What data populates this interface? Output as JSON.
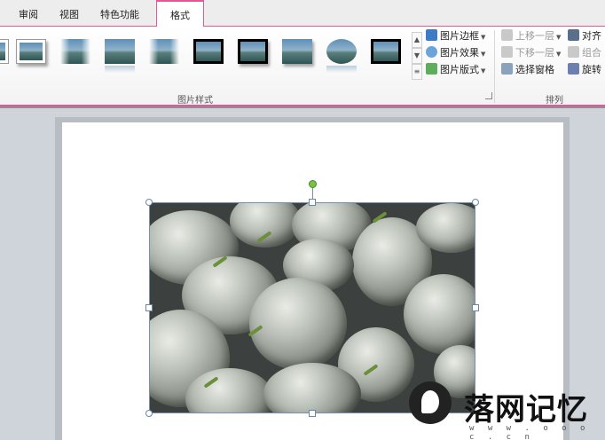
{
  "tabs": [
    {
      "label": "审阅",
      "active": false
    },
    {
      "label": "视图",
      "active": false
    },
    {
      "label": "特色功能",
      "active": false
    },
    {
      "label": "格式",
      "active": true
    }
  ],
  "ribbon": {
    "picture_styles": {
      "group_label": "图片样式",
      "commands": {
        "border": "图片边框",
        "effects": "图片效果",
        "layout": "图片版式"
      }
    },
    "arrange": {
      "group_label": "排列",
      "commands": {
        "bring_forward": "上移一层",
        "send_backward": "下移一层",
        "selection_pane": "选择窗格",
        "align": "对齐",
        "group": "组合",
        "rotate": "旋转"
      }
    }
  },
  "watermark": {
    "title": "落网记忆",
    "subtitle": "w w w . o o o c . c n"
  },
  "colors": {
    "accent": "#e05a9a",
    "rotate_handle": "#7ac143"
  }
}
